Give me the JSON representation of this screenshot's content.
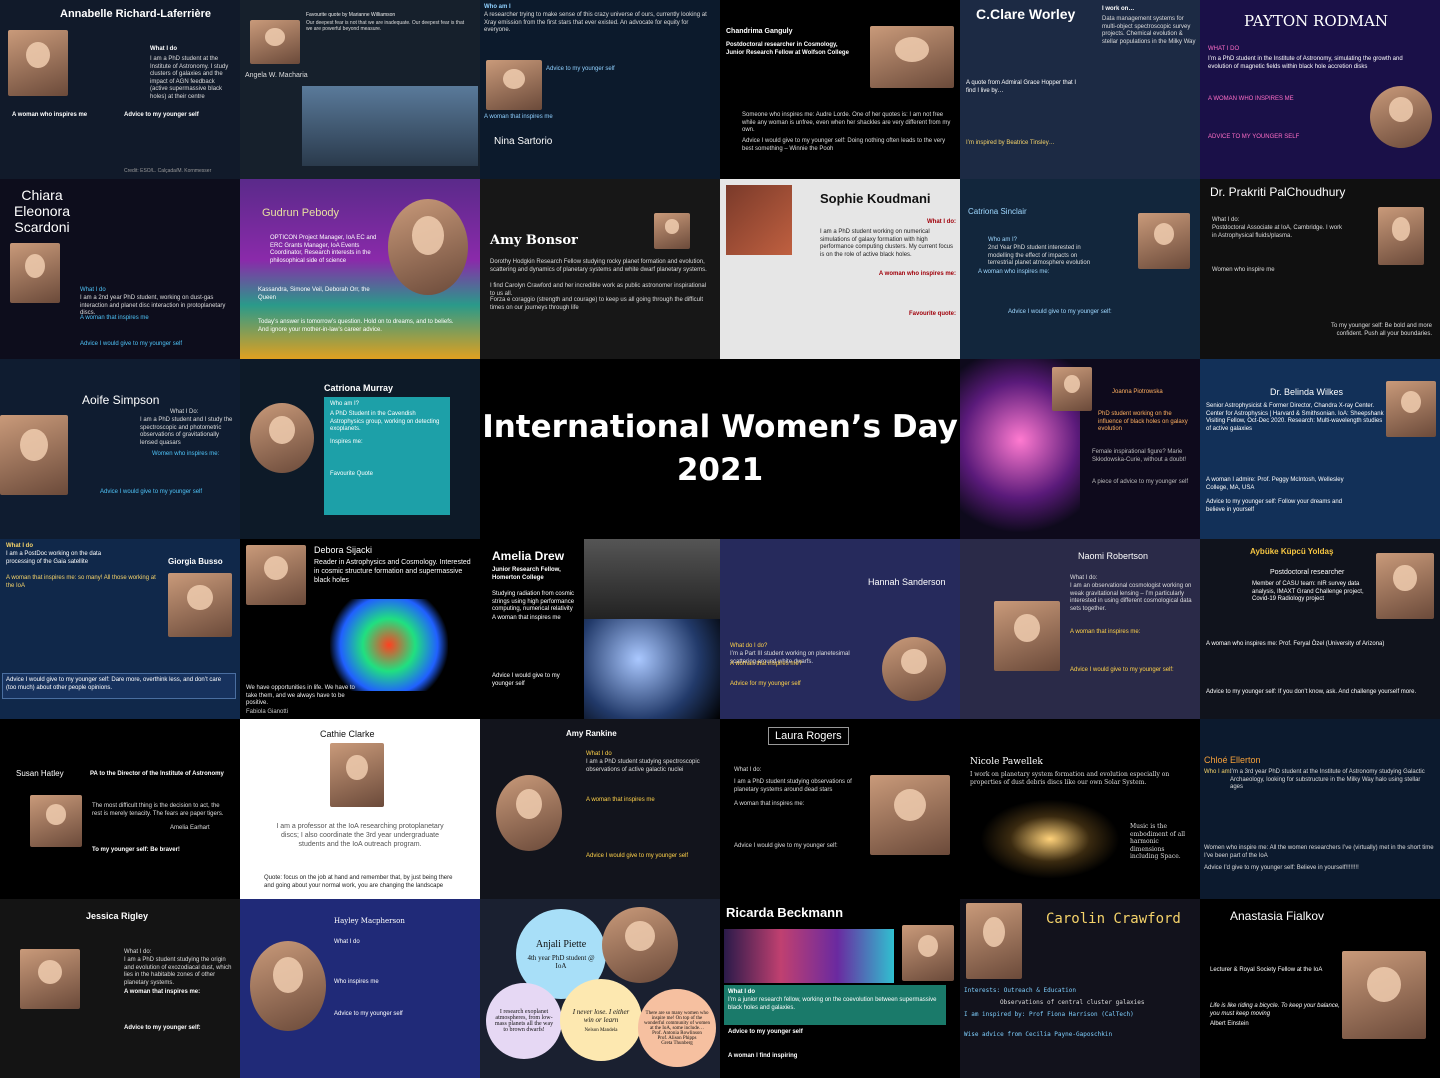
{
  "center": {
    "title_line1": "International Women’s Day",
    "title_line2": "2021"
  },
  "tiles": [
    {
      "name": "Annabelle Richard-Laferrière",
      "heading": "What I do",
      "text": "I am a PhD student at the Institute of Astronomy. I study clusters of galaxies and the impact of AGN feedback (active supermassive black holes) at their centre",
      "sub1": "A woman who inspires me",
      "sub2": "Advice to my younger self",
      "credit": "Credit: ESO/L. Calçada/M. Kornmesser",
      "bg": "#111a2a"
    },
    {
      "name": "Angela W. Macharia",
      "heading": "Favourite quote by Marianne Williamson",
      "text": "Our deepest fear is not that we are inadequate. Our deepest fear is that we are powerful beyond measure.",
      "bg": "#16202c"
    },
    {
      "name": "Nina Sartorio",
      "heading": "Who am I",
      "text": "A researcher trying to make sense of this crazy universe of ours, currently looking at Xray emission from the first stars that ever existed. An advocate for equity for everyone.",
      "sub1": "Advice to my younger self",
      "sub2": "A woman that inspires me",
      "bg": "#0c1a2c"
    },
    {
      "name": "Chandrima Ganguly",
      "heading": "Postdoctoral researcher in Cosmology, Junior Research Fellow at Wolfson College",
      "text": "Someone who inspires me: Audre Lorde. One of her quotes is: I am not free while any woman is unfree, even when her shackles are very different from my own.",
      "sub1": "Advice I would give to my younger self: Doing nothing often leads to the very best something – Winnie the Pooh",
      "bg": "#000000"
    },
    {
      "name": "C.Clare Worley",
      "heading": "I work on…",
      "text": "Data management systems for multi-object spectroscopic survey projects. Chemical evolution & stellar populations in the Milky Way",
      "sub1": "A quote from Admiral Grace Hopper that I find I live by…",
      "sub2": "I’m inspired by Beatrice Tinsley…",
      "bg": "#1c2a44"
    },
    {
      "name": "PAYTON RODMAN",
      "heading": "WHAT I DO",
      "text": "I’m a PhD student in the Institute of Astronomy, simulating the growth and evolution of magnetic fields within black hole accretion disks",
      "sub1": "A WOMAN WHO INSPIRES ME",
      "sub2": "ADVICE TO MY YOUNGER SELF",
      "bg": "#1a1048"
    },
    {
      "name": "Chiara Eleonora Scardoni",
      "heading": "What I do",
      "text": "I am a 2nd year PhD student, working on dust-gas interaction and planet disc interaction in protoplanetary discs.",
      "sub1": "A woman that inspires me",
      "sub2": "Advice I would give to my younger self",
      "bg": "#0d0d1c"
    },
    {
      "name": "Gudrun Pebody",
      "heading": "",
      "text": "OPTICON Project Manager, IoA EC and ERC Grants Manager, IoA Events Coordinator, Research interests in the philosophical side of science",
      "sub1": "Kassandra, Simone Veil, Deborah Orr, the Queen",
      "sub2": "Today’s answer is tomorrow’s question. Hold on to dreams, and to beliefs. And ignore your mother-in-law’s career advice.",
      "bg": "#5a2a8a"
    },
    {
      "name": "Amy Bonsor",
      "heading": "",
      "text": "Dorothy Hodgkin Research Fellow studying rocky planet formation and evolution, scattering and dynamics of planetary systems and white dwarf planetary systems.",
      "sub1": "I find Carolyn Crawford and her incredible work as public astronomer inspirational to us all.",
      "sub2": "Forza e coraggio (strength and courage) to keep us all going through the difficult times on our journeys through life",
      "bg": "#171717"
    },
    {
      "name": "Sophie Koudmani",
      "heading": "What I do:",
      "text": "I am a PhD student working on numerical simulations of galaxy formation with high performance computing clusters. My current focus is on the role of active black holes.",
      "sub1": "A woman who inspires me:",
      "sub2": "Favourite quote:",
      "bg": "#e6e6e6"
    },
    {
      "name": "Catriona Sinclair",
      "heading": "Who am I?",
      "text": "2nd Year PhD student interested in modelling the effect of impacts on terrestrial planet atmosphere evolution",
      "sub1": "A woman who inspires me:",
      "sub2": "Advice I would give to my younger self:",
      "bg": "#12263c"
    },
    {
      "name": "Dr. Prakriti PalChoudhury",
      "heading": "What I do:",
      "text": "Postdoctoral Associate at IoA, Cambridge. I work in Astrophysical fluids/plasma.",
      "sub1": "Women who inspire me",
      "sub2": "To my younger self: Be bold and more confident. Push all your boundaries.",
      "bg": "#101010"
    },
    {
      "name": "Aoife Simpson",
      "heading": "What I Do:",
      "text": "I am a PhD student and I study the spectroscopic and photometric observations of gravitationally lensed quasars",
      "sub1": "Women who inspires me:",
      "sub2": "Advice I would give to my younger self",
      "bg": "#0f1c30"
    },
    {
      "name": "Catriona Murray",
      "heading": "Who am I?",
      "text": "A PhD Student in the Cavendish Astrophysics group, working on detecting exoplanets.",
      "sub1": "Inspires me:",
      "sub2": "Favourite Quote",
      "bg": "#0d1a28"
    },
    {
      "name": "Joanna Piotrowska",
      "heading": "",
      "text": "PhD student working on the influence of black holes on galaxy evolution",
      "sub1": "Female inspirational figure? Marie Skłodowska-Curie, without a doubt!",
      "sub2": "A piece of advice to my younger self",
      "bg": "#0e0a1c"
    },
    {
      "name": "Dr. Belinda Wilkes",
      "heading": "",
      "text": "Senior Astrophysicist & Former Director, Chandra X-ray Center. Center for Astrophysics | Harvard & Smithsonian. IoA: Sheepshank Visiting Fellow, Oct-Dec 2020. Research: Multi-wavelength studies of active galaxies",
      "sub1": "A woman I admire: Prof. Peggy McIntosh, Wellesley College, MA, USA",
      "sub2": "Advice to my younger self: Follow your dreams and believe in yourself",
      "bg": "#123058"
    },
    {
      "name": "Giorgia Busso",
      "heading": "What I do",
      "text": "I am a PostDoc working on the data processing of the Gaia satellite",
      "sub1": "A woman that inspires me: so many! All those working at the IoA",
      "sub2": "Advice I would give to my younger self: Dare more, overthink less, and don’t care (too much) about other people opinions.",
      "bg": "#10284a"
    },
    {
      "name": "Debora Sijacki",
      "heading": "",
      "text": "Reader in Astrophysics and Cosmology. Interested in cosmic structure formation and supermassive black holes",
      "sub1": "We have opportunities in life. We have to take them, and we always have to be positive.",
      "sub2": "Fabiola Gianotti",
      "bg": "#000000"
    },
    {
      "name": "Amelia Drew",
      "heading": "Junior Research Fellow, Homerton College",
      "text": "Studying radiation from cosmic strings using high performance computing, numerical relativity",
      "sub1": "A woman that inspires me",
      "sub2": "Advice I would give to my younger self",
      "bg": "#000000"
    },
    {
      "name": "Hannah Sanderson",
      "heading": "What do I do?",
      "text": "I’m a Part III student working on planetesimal scattering around white dwarfs.",
      "sub1": "A woman that inspires me?",
      "sub2": "Advice for my younger self",
      "bg": "#262a5c"
    },
    {
      "name": "Naomi Robertson",
      "heading": "What I do:",
      "text": "I am an observational cosmologist working on weak gravitational lensing – I’m particularly interested in using different cosmological data sets together.",
      "sub1": "A woman that inspires me:",
      "sub2": "Advice I would give to my younger self:",
      "bg": "#2a2a48"
    },
    {
      "name": "Aybüke Küpcü Yoldaş",
      "heading": "Postdoctoral researcher",
      "text": "Member of CASU team: nIR survey data analysis, IMAXT Grand Challenge project, Covid-19 Radiology project",
      "sub1": "A woman who inspires me: Prof. Feryal Özel (University of Arizona)",
      "sub2": "Advice to my younger self: If you don’t know, ask. And challenge yourself more.",
      "bg": "#10131c"
    },
    {
      "name": "Susan Hatley",
      "heading": "PA to the Director of the Institute of Astronomy",
      "text": "The most difficult thing is the decision to act, the rest is merely tenacity. The fears are paper tigers.",
      "sub1": "Amelia Earhart",
      "sub2": "To my younger self: Be braver!",
      "bg": "#000000"
    },
    {
      "name": "Cathie Clarke",
      "heading": "",
      "text": "I am a professor at the IoA researching protoplanetary discs; I also coordinate the 3rd year undergraduate students and the IoA outreach program.",
      "sub1": "Quote: focus on the job at hand and remember that, by just being there and going about your normal work, you are changing the landscape",
      "sub2": "",
      "bg": "#ffffff"
    },
    {
      "name": "Amy Rankine",
      "heading": "What I do",
      "text": "I am a PhD student studying spectroscopic observations of active galactic nuclei",
      "sub1": "A woman that inspires me",
      "sub2": "Advice I would give to my younger self",
      "bg": "#12141c"
    },
    {
      "name": "Laura Rogers",
      "heading": "What I do:",
      "text": "I am a PhD student studying observations of planetary systems around dead stars",
      "sub1": "A woman that inspires me:",
      "sub2": "Advice I would give to my younger self:",
      "bg": "#000000"
    },
    {
      "name": "Nicole Pawellek",
      "heading": "",
      "text": "I work on planetary system formation and evolution especially on properties of dust debris discs like our own Solar System.",
      "sub1": "Music is the embodiment of all harmonic dimensions including Space.",
      "sub2": "",
      "bg": "#000000"
    },
    {
      "name": "Chloé Ellerton",
      "heading": "Who I am:",
      "text": "I’m a 3rd year PhD student at the Institute of Astronomy studying Galactic Archaeology, looking for substructure in the Milky Way halo using stellar ages",
      "sub1": "Women who inspire me: All the women researchers I’ve (virtually) met in the short time I’ve been part of the IoA",
      "sub2": "Advice I’d give to my younger self: Believe in yourself!!!!!!!!",
      "bg": "#0c1a2e"
    },
    {
      "name": "Jessica Rigley",
      "heading": "What I do:",
      "text": "I am a PhD student studying the origin and evolution of exozodiacal dust, which lies in the habitable zones of other planetary systems.",
      "sub1": "A woman that inspires me:",
      "sub2": "Advice to my younger self:",
      "bg": "#141414"
    },
    {
      "name": "Hayley Macpherson",
      "heading": "",
      "text": "What I do",
      "sub1": "Who inspires me",
      "sub2": "Advice to my younger self",
      "bg": "#202a78"
    },
    {
      "name": "Anjali Piette",
      "heading": "4th year PhD student @ IoA",
      "text": "I research exoplanet atmospheres, from low-mass planets all the way to brown dwarfs!",
      "sub1": "I never lose. I either win or learn",
      "sub2": "Nelson Mandela",
      "bg": "#1a2030"
    },
    {
      "name": "Ricarda Beckmann",
      "heading": "What I do",
      "text": "I’m a junior research fellow, working on the coevolution between supermassive black holes and galaxies.",
      "sub1": "Advice to my younger self",
      "sub2": "A woman I find inspiring",
      "bg": "#000000"
    },
    {
      "name": "Carolin Crawford",
      "heading": "Interests: Outreach & Education",
      "text": "Observations of central cluster galaxies",
      "sub1": "I am inspired by: Prof Fiona Harrison (CalTech)",
      "sub2": "Wise advice from Cecilia Payne-Gaposchkin",
      "bg": "#12121c"
    },
    {
      "name": "Anastasia Fialkov",
      "heading": "",
      "text": "Lecturer & Royal Society Fellow at the IoA",
      "sub1": "Life is like riding a bicycle. To keep your balance, you must keep moving",
      "sub2": "Albert Einstein",
      "bg": "#000000"
    }
  ],
  "bubbles": [
    {
      "text": "There are so many women who inspire me! On top of the wonderful community of women at the IoA, some include…",
      "b1": "Prof. Antonia Rowlinson",
      "b2": "Prof. Alison Phipps",
      "b3": "Greta Thunberg"
    }
  ]
}
